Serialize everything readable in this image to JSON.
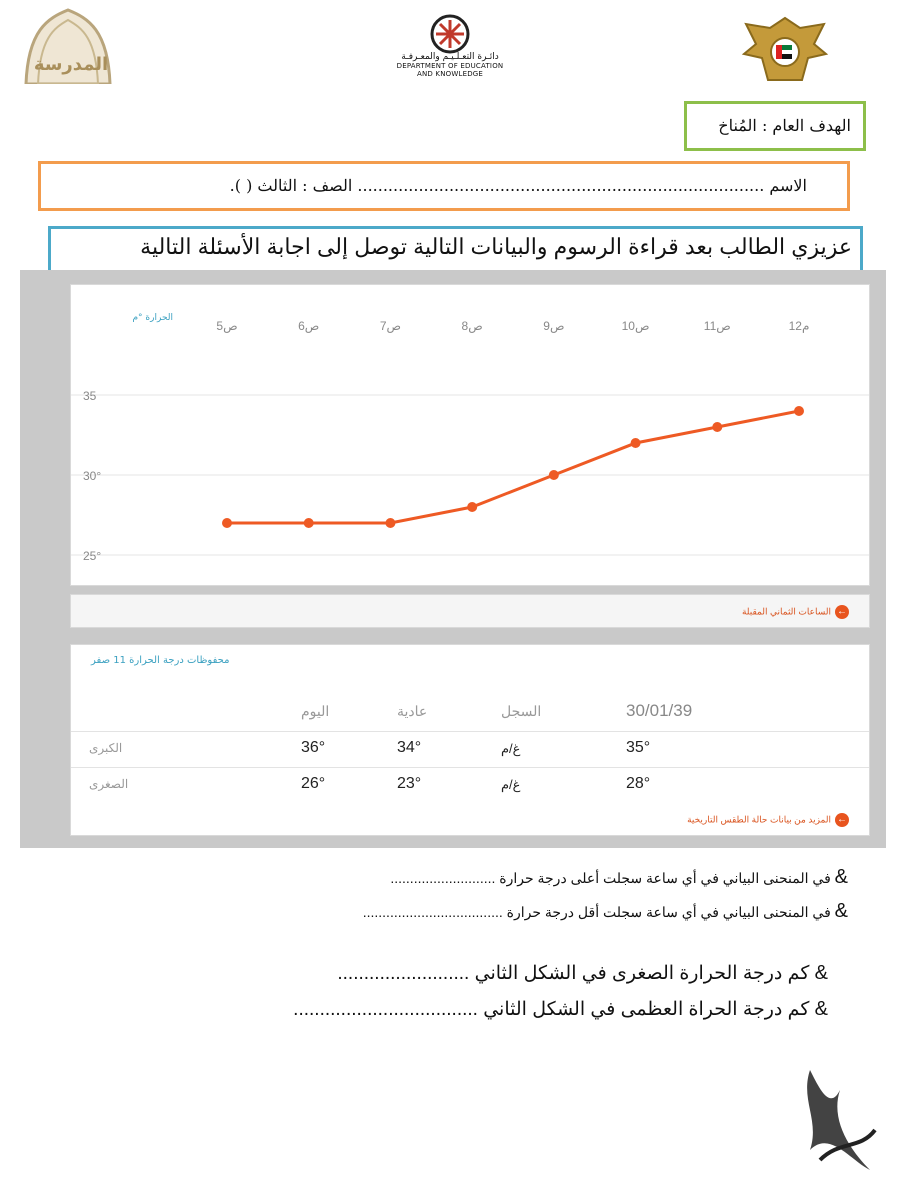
{
  "header": {
    "school_logo_text": "المدرسة",
    "dept_name_ar": "دائـرة التعـلـيـم والمعـرفـة",
    "dept_name_en_line1": "DEPARTMENT OF EDUCATION",
    "dept_name_en_line2": "AND KNOWLEDGE"
  },
  "goal": {
    "text": "الهدف العام : المُناخ"
  },
  "student": {
    "text": "الاسم ................................................................................  الصف : الثالث   (      )."
  },
  "instruction": {
    "text": "عزيزي الطالب بعد قراءة الرسوم والبيانات التالية توصل إلى اجابة الأسئلة التالية"
  },
  "colors": {
    "line": "#ee5a24",
    "goal_border": "#8dbf4a",
    "name_border": "#f39c4d",
    "instr_border": "#4ca9c9",
    "axis_label": "#3aa0c0"
  },
  "chart_data": {
    "type": "line",
    "y_axis_label": "الحرارة °م",
    "categories": [
      "5ص",
      "6ص",
      "7ص",
      "8ص",
      "9ص",
      "10ص",
      "11ص",
      "12م"
    ],
    "series": [
      {
        "values": [
          27,
          27,
          27,
          28,
          30,
          32,
          33,
          34
        ]
      }
    ],
    "y_ticks": [
      "35",
      "30°",
      "25°"
    ],
    "ylim": [
      25,
      35
    ],
    "grid": true
  },
  "hours_link": "الساعات الثماني المقبلة",
  "table": {
    "title": "محفوظات درجة الحرارة 11 صفر",
    "headers": {
      "today": "اليوم",
      "normal": "عادية",
      "record": "السجل",
      "date": "30/01/39"
    },
    "rows": [
      {
        "label": "الكبرى",
        "today": "36°",
        "normal": "34°",
        "record": "غ/م",
        "date": "35°"
      },
      {
        "label": "الصغرى",
        "today": "26°",
        "normal": "23°",
        "record": "غ/م",
        "date": "28°"
      }
    ],
    "more_link": "المزيد من بيانات حالة الطقس التاريخية"
  },
  "questions": [
    {
      "bullet": "&",
      "text": "في المنحنى البياني في أي ساعة سجلت  أعلى درجة حرارة ..........................."
    },
    {
      "bullet": "&",
      "text": "في المنحنى البياني في أي ساعة سجلت  أقل  درجة حرارة ...................................."
    },
    {
      "bullet": "&",
      "text": "كم درجة الحرارة الصغرى  في الشكل الثاني ........................."
    },
    {
      "bullet": "&",
      "text": "كم درجة الحراة العظمى في الشكل الثاني ..................................."
    }
  ]
}
